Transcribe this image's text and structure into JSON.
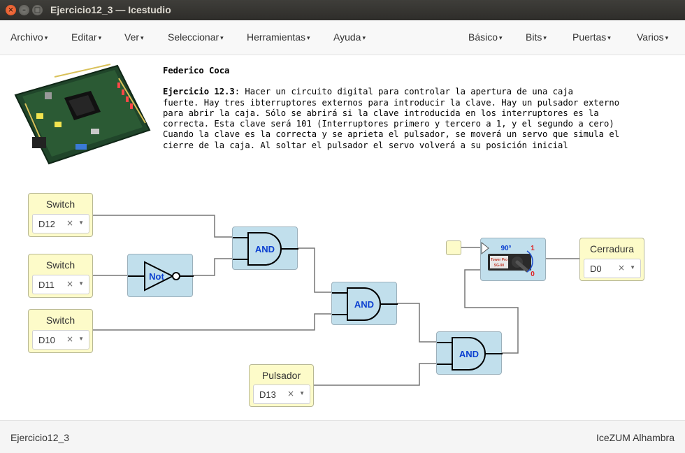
{
  "window": {
    "title": "Ejercicio12_3 — Icestudio",
    "close_glyph": "×",
    "minimize_glyph": "–",
    "maximize_glyph": "□"
  },
  "menu": {
    "caret": "▾",
    "left": [
      "Archivo",
      "Editar",
      "Ver",
      "Seleccionar",
      "Herramientas",
      "Ayuda"
    ],
    "right": [
      "Básico",
      "Bits",
      "Puertas",
      "Varios"
    ]
  },
  "info": {
    "author": "Federico Coca",
    "exercise_label": "Ejercicio 12.3",
    "lines": [
      ": Hacer un circuito digital para controlar la apertura de una caja",
      "fuerte. Hay tres ibterruptores externos para introducir la clave. Hay un pulsador externo",
      "para abrir la caja. Sólo se abrirá si la clave introducida en los interruptores es la",
      "correcta. Esta clave será 101 (Interruptores primero y tercero a 1, y el segundo a cero)",
      "Cuando la clave es la correcta y se aprieta el pulsador, se moverá un servo que simula el",
      "cierre de la caja. Al soltar el pulsador el servo volverá a su posición inicial"
    ]
  },
  "circuit": {
    "inputs": [
      {
        "label": "Switch",
        "pin": "D12"
      },
      {
        "label": "Switch",
        "pin": "D11"
      },
      {
        "label": "Switch",
        "pin": "D10"
      },
      {
        "label": "Pulsador",
        "pin": "D13"
      }
    ],
    "output": {
      "label": "Cerradura",
      "pin": "D0"
    },
    "select_clear_glyph": "×",
    "select_arrow_glyph": "▼",
    "gates": {
      "not": "Not",
      "and": "AND"
    },
    "servo": {
      "angle": "90°",
      "brand": "Tower Pro",
      "model": "SG-90",
      "on": "1",
      "off": "0"
    }
  },
  "status": {
    "left": "Ejercicio12_3",
    "right": "IceZUM Alhambra"
  }
}
